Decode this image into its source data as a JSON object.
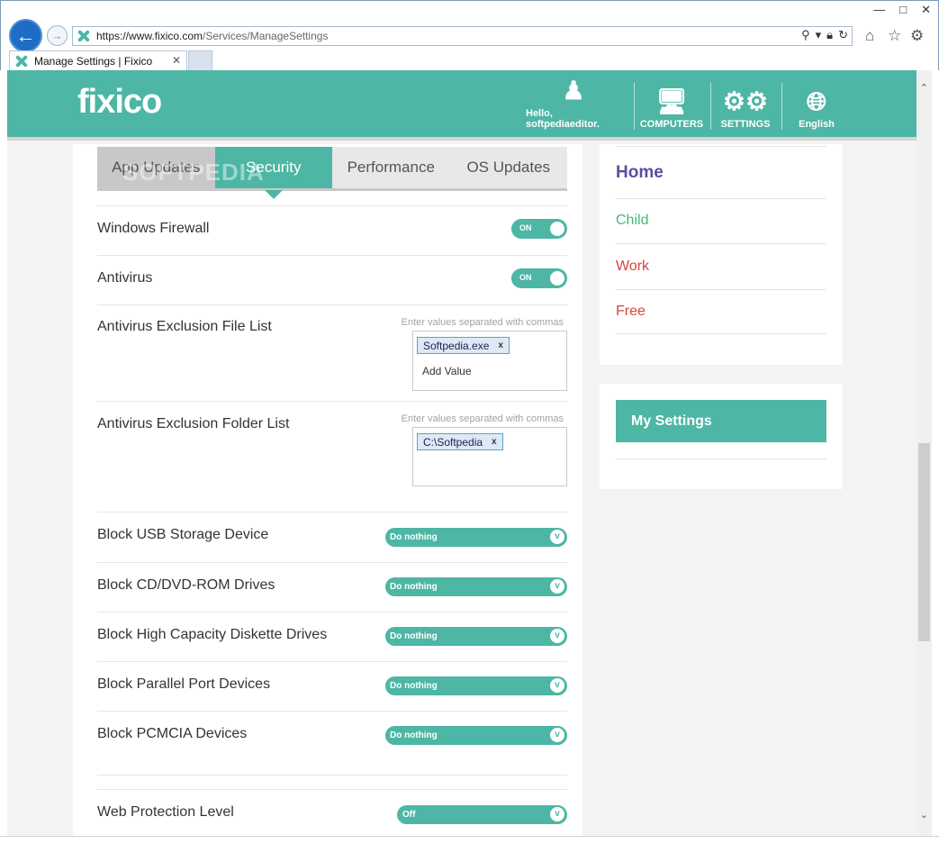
{
  "browser": {
    "url_main": "https://www.",
    "url_domain": "fixico.com",
    "url_path": "/Services/ManageSettings",
    "tab_title": "Manage Settings | Fixico"
  },
  "header": {
    "logo": "fixico",
    "user_label": "Hello, softpediaeditor.",
    "computers_label": "COMPUTERS",
    "settings_label": "SETTINGS",
    "language_label": "English"
  },
  "tabs": [
    "App Updates",
    "Security",
    "Performance",
    "OS Updates"
  ],
  "watermark": "SOFTPEDIA",
  "settings": {
    "firewall": {
      "label": "Windows Firewall",
      "state": "ON"
    },
    "antivirus": {
      "label": "Antivirus",
      "state": "ON"
    },
    "file_list": {
      "label": "Antivirus Exclusion File List",
      "hint": "Enter values separated with commas",
      "tag": "Softpedia.exe",
      "placeholder": "Add Value"
    },
    "folder_list": {
      "label": "Antivirus Exclusion Folder List",
      "hint": "Enter values separated with commas",
      "tag": "C:\\Softpedia"
    },
    "usb": {
      "label": "Block USB Storage Device",
      "value": "Do nothing"
    },
    "cd": {
      "label": "Block CD/DVD-ROM Drives",
      "value": "Do nothing"
    },
    "diskette": {
      "label": "Block High Capacity Diskette Drives",
      "value": "Do nothing"
    },
    "parallel": {
      "label": "Block Parallel Port Devices",
      "value": "Do nothing"
    },
    "pcmcia": {
      "label": "Block PCMCIA Devices",
      "value": "Do nothing"
    },
    "web": {
      "label": "Web Protection Level",
      "value": "Off"
    }
  },
  "dropdown_arrow": "v",
  "tag_remove": "x",
  "side": {
    "home": "Home",
    "child": "Child",
    "work": "Work",
    "free": "Free",
    "my_settings": "My Settings"
  },
  "colors": {
    "brand": "#4db6a4",
    "home": "#5a4ea0",
    "child": "#48b878",
    "work": "#d9443f",
    "free": "#d9443f"
  }
}
